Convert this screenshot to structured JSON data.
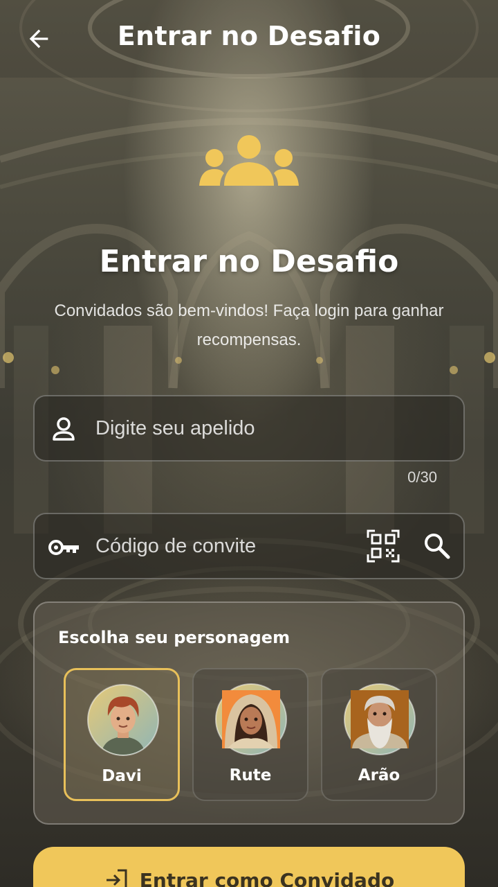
{
  "header": {
    "title": "Entrar no Desafio",
    "back_icon": "arrow-left-icon"
  },
  "hero": {
    "icon": "group-icon",
    "title": "Entrar no Desafio",
    "subtitle": "Convidados são bem-vindos! Faça login para ganhar recompensas."
  },
  "nickname": {
    "placeholder": "Digite seu apelido",
    "value": "",
    "counter": "0/30",
    "icon": "person-icon"
  },
  "invite_code": {
    "placeholder": "Código de convite",
    "value": "",
    "icon": "key-icon",
    "qr_icon": "qr-scan-icon",
    "search_icon": "search-icon"
  },
  "characters": {
    "heading": "Escolha seu personagem",
    "selected": "Davi",
    "items": [
      {
        "name": "Davi"
      },
      {
        "name": "Rute"
      },
      {
        "name": "Arão"
      }
    ]
  },
  "guest_button": {
    "label": "Entrar como Convidado",
    "icon": "login-icon"
  },
  "colors": {
    "accent": "#f0c75a",
    "selected_border": "#e8c05a",
    "button_text": "#3b3320"
  }
}
